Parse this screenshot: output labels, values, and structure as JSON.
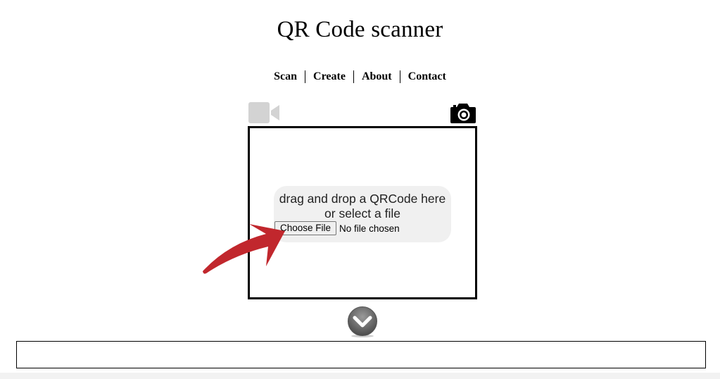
{
  "page": {
    "title": "QR Code scanner"
  },
  "nav": {
    "items": [
      {
        "label": "Scan"
      },
      {
        "label": "Create"
      },
      {
        "label": "About"
      },
      {
        "label": "Contact"
      }
    ]
  },
  "scanner": {
    "video_icon": "video-camera-icon",
    "camera_icon": "photo-camera-icon",
    "drop_text_line1": "drag and drop a QRCode here",
    "drop_text_line2": "or select a file",
    "choose_file_label": "Choose File",
    "file_status": "No file chosen",
    "arrow_icon": "red-arrow-icon",
    "expand_icon": "chevron-down-icon"
  },
  "result": {
    "value": ""
  },
  "colors": {
    "frame": "#000000",
    "drop_zone_bg": "#f0f0f0",
    "video_icon": "#d3d3d3",
    "arrow": "#c1272d",
    "expand_button": "#6b6b6b"
  }
}
